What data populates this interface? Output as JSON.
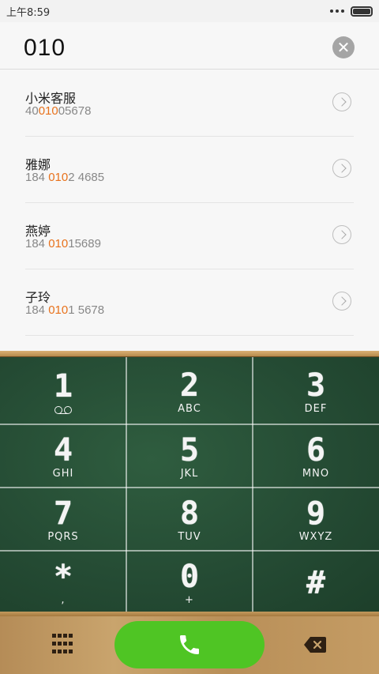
{
  "status": {
    "time": "上午8:59"
  },
  "dial": {
    "number": "010",
    "clear_label": "✕"
  },
  "results": [
    {
      "name": "小米客服",
      "pre": "40",
      "match": "010",
      "post": "05678"
    },
    {
      "name": "雅娜",
      "pre": "184 ",
      "match": "010",
      "post": "2 4685"
    },
    {
      "name": "燕婷",
      "pre": "184 ",
      "match": "010",
      "post": "15689"
    },
    {
      "name": "子玲",
      "pre": "184 ",
      "match": "010",
      "post": "1 5678"
    }
  ],
  "keypad": [
    {
      "digit": "1",
      "letters": ""
    },
    {
      "digit": "2",
      "letters": "ABC"
    },
    {
      "digit": "3",
      "letters": "DEF"
    },
    {
      "digit": "4",
      "letters": "GHI"
    },
    {
      "digit": "5",
      "letters": "JKL"
    },
    {
      "digit": "6",
      "letters": "MNO"
    },
    {
      "digit": "7",
      "letters": "PQRS"
    },
    {
      "digit": "8",
      "letters": "TUV"
    },
    {
      "digit": "9",
      "letters": "WXYZ"
    },
    {
      "digit": "*",
      "letters": ","
    },
    {
      "digit": "0",
      "letters": "+"
    },
    {
      "digit": "#",
      "letters": ""
    }
  ],
  "colors": {
    "call_green": "#4fc524",
    "match_orange": "#e8721c",
    "board_green": "#244a33"
  },
  "icons": {
    "call": "phone-icon",
    "backspace": "backspace-icon",
    "dialpad": "dialpad-grid-icon",
    "voicemail": "voicemail-icon"
  }
}
